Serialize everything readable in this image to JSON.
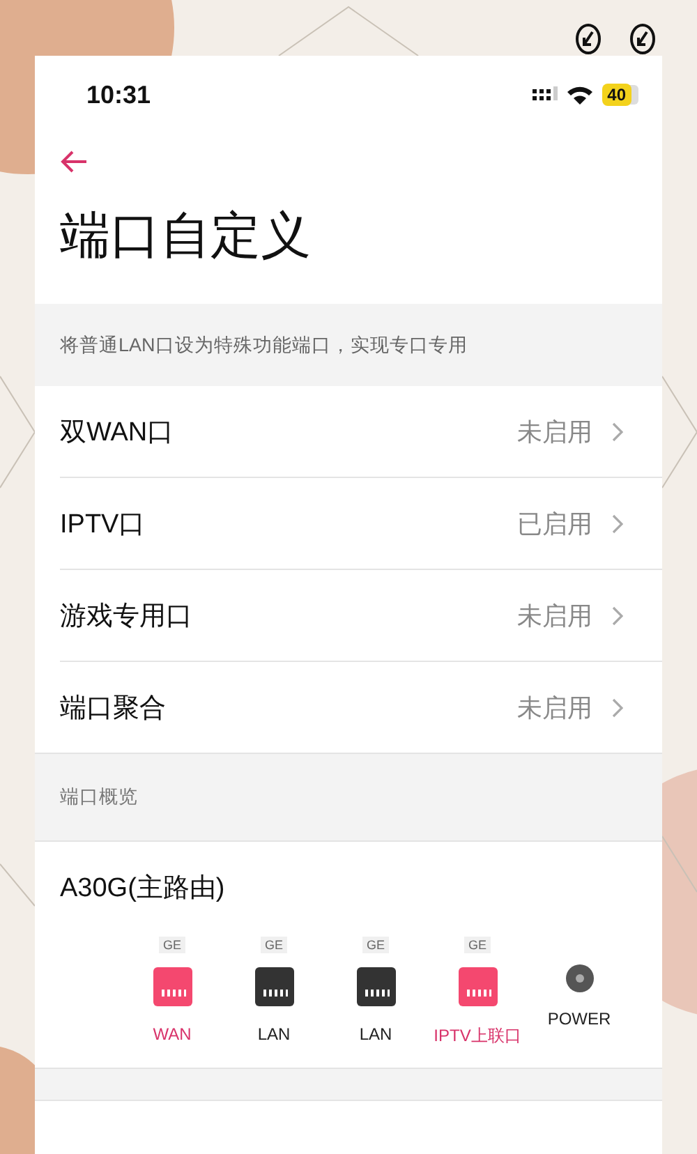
{
  "status_bar": {
    "time": "10:31",
    "battery": "40"
  },
  "page": {
    "title": "端口自定义",
    "description": "将普通LAN口设为特殊功能端口，实现专口专用"
  },
  "settings": [
    {
      "label": "双WAN口",
      "value": "未启用"
    },
    {
      "label": "IPTV口",
      "value": "已启用"
    },
    {
      "label": "游戏专用口",
      "value": "未启用"
    },
    {
      "label": "端口聚合",
      "value": "未启用"
    }
  ],
  "overview": {
    "header": "端口概览",
    "device": "A30G(主路由)",
    "ports": [
      {
        "kind": "port",
        "badge": "GE",
        "label": "WAN",
        "active": true
      },
      {
        "kind": "port",
        "badge": "GE",
        "label": "LAN",
        "active": false
      },
      {
        "kind": "port",
        "badge": "GE",
        "label": "LAN",
        "active": false
      },
      {
        "kind": "port",
        "badge": "GE",
        "label": "IPTV上联口",
        "active": true
      },
      {
        "kind": "power",
        "label": "POWER"
      }
    ]
  }
}
